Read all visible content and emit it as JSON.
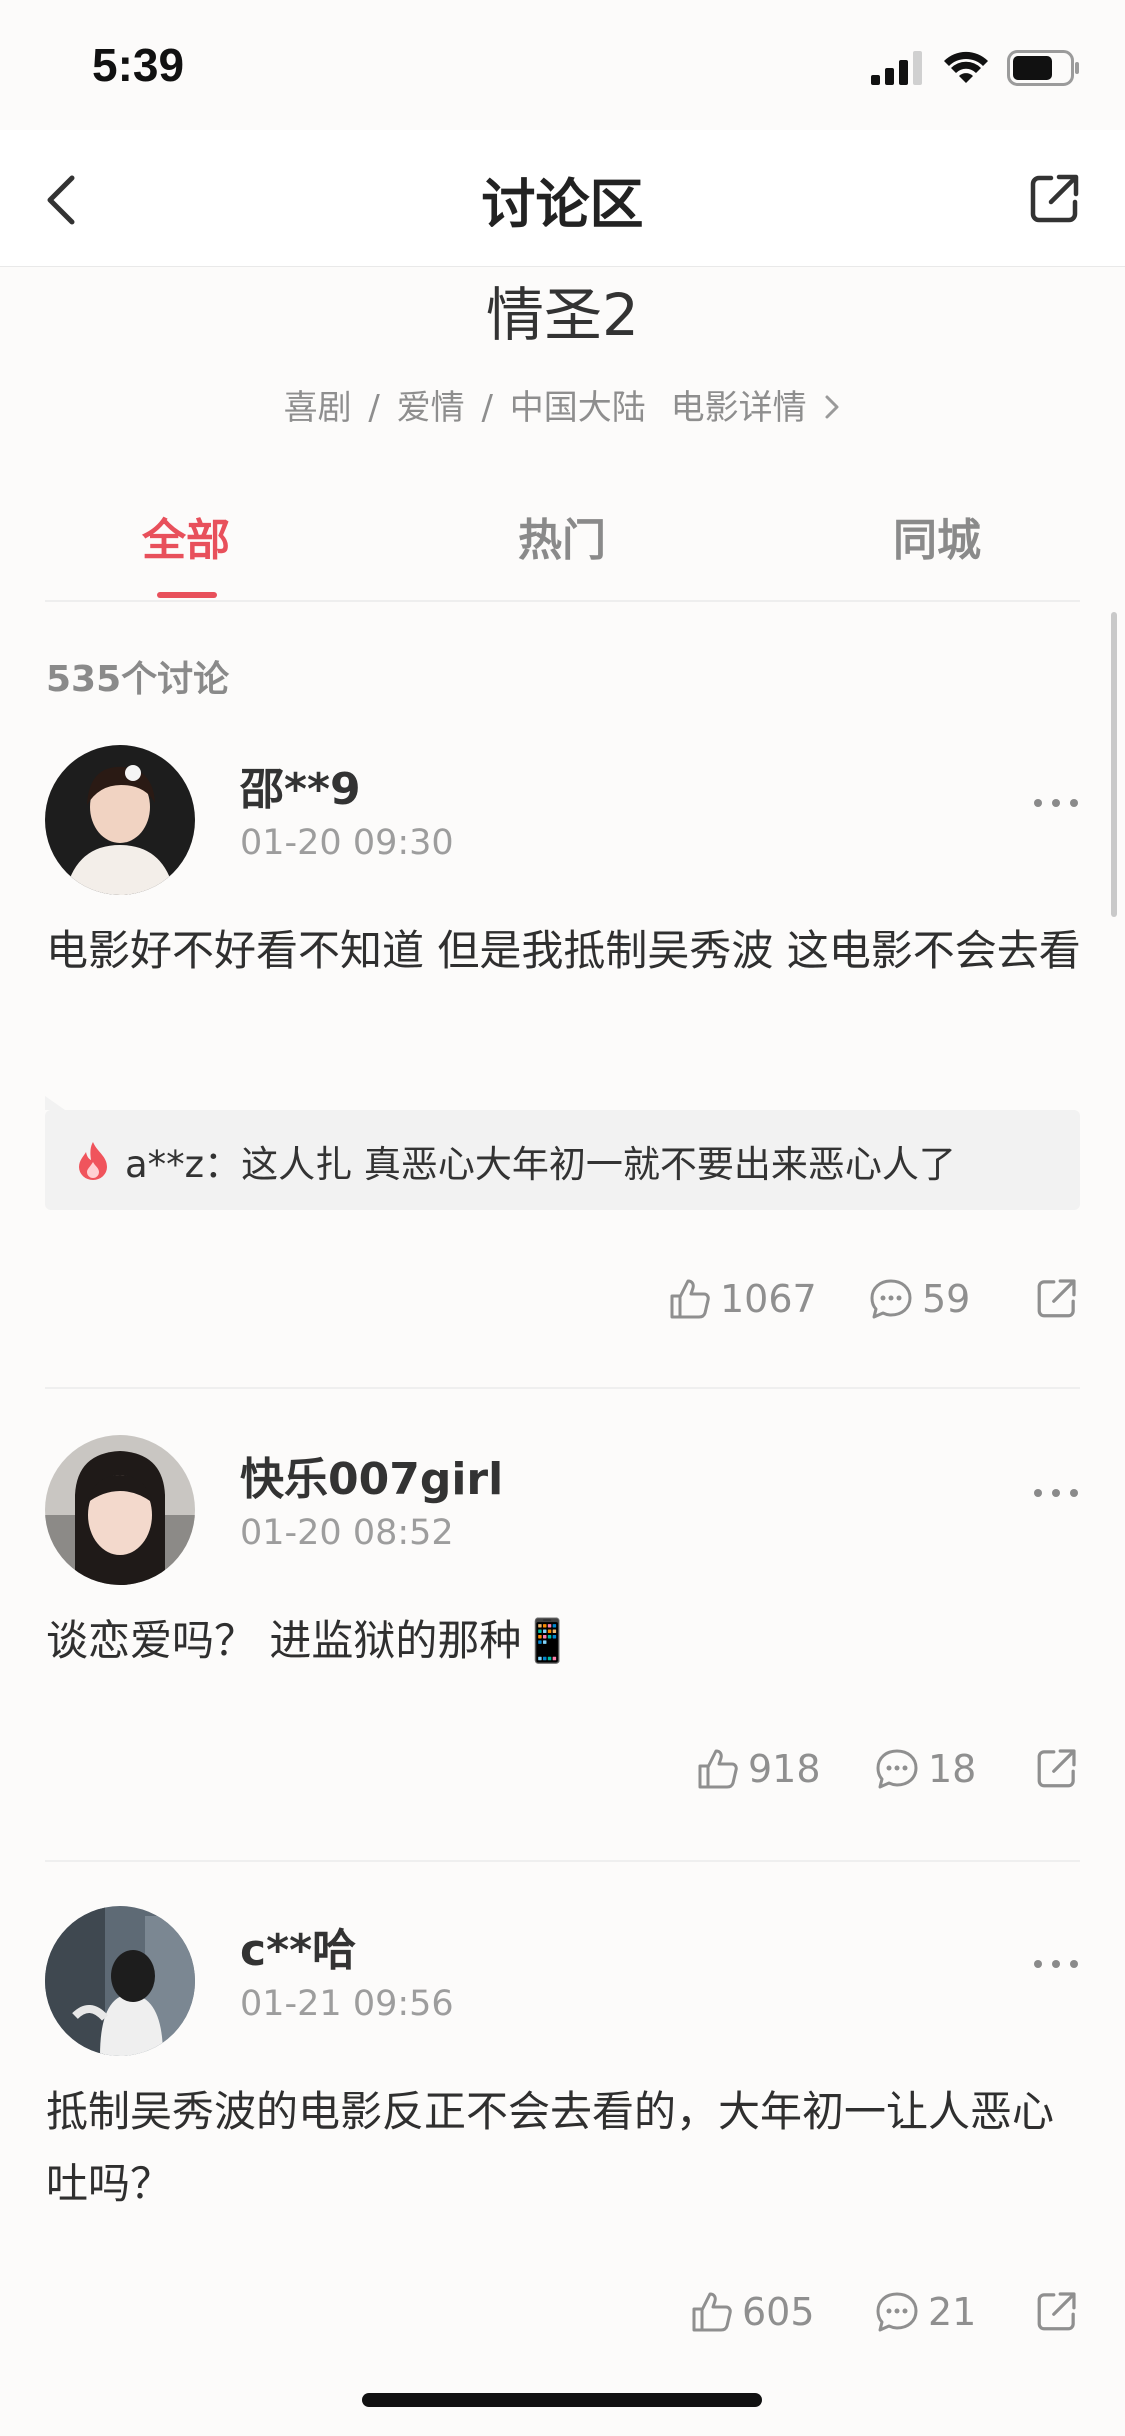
{
  "status_bar": {
    "time": "5:39",
    "battery_level": 0.7
  },
  "header": {
    "title": "讨论区",
    "back_icon": "chevron-left-icon",
    "share_icon": "share-icon"
  },
  "movie": {
    "title": "情圣2",
    "genres": [
      "喜剧",
      "爱情",
      "中国大陆"
    ],
    "details_link": "电影详情"
  },
  "tabs": [
    {
      "label": "全部",
      "active": true
    },
    {
      "label": "热门",
      "active": false
    },
    {
      "label": "同城",
      "active": false
    }
  ],
  "discussion_count": "535个讨论",
  "accent_color": "#e8505b",
  "posts": [
    {
      "username": "邵**9",
      "time": "01-20 09:30",
      "content": "电影好不好看不知道 但是我抵制吴秀波 这电影不会去看",
      "hot_reply": {
        "icon": "flame-icon",
        "user": "a**z",
        "separator": "：",
        "text": "这人扎 真恶心大年初一就不要出来恶心人了"
      },
      "likes": "1067",
      "comments": "59"
    },
    {
      "username": "快乐007girl",
      "time": "01-20 08:52",
      "content": "谈恋爱吗？ 进监狱的那种📱",
      "likes": "918",
      "comments": "18"
    },
    {
      "username": "c**哈",
      "time": "01-21 09:56",
      "content": "抵制吴秀波的电影反正不会去看的，大年初一让人恶心吐吗？",
      "likes": "605",
      "comments": "21"
    }
  ]
}
